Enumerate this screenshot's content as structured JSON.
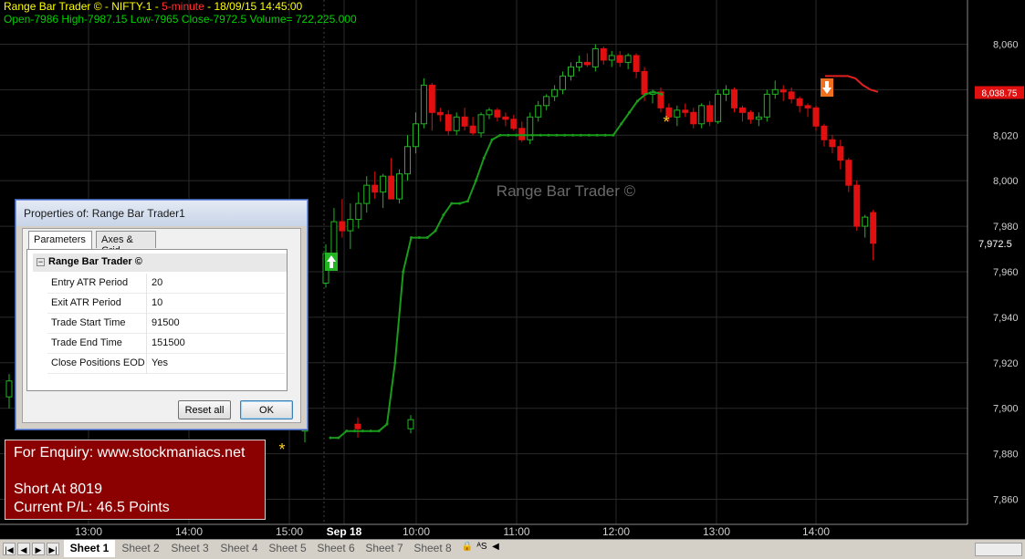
{
  "header": {
    "title_prefix": "Range Bar Trader © - NIFTY-1 - ",
    "interval": "5-minute",
    "title_suffix": " - 18/09/15 14:45:00",
    "ohlc": "Open-7986  High-7987.15  Low-7965  Close-7972.5  Volume= 722,225.000"
  },
  "watermark": "Range Bar Trader ©",
  "dialog": {
    "title": "Properties of: Range Bar Trader1",
    "tabs": [
      "Parameters",
      "Axes & Grid"
    ],
    "group": "Range Bar Trader ©",
    "group_toggle": "−",
    "params": [
      {
        "name": "Entry ATR Period",
        "value": "20"
      },
      {
        "name": "Exit ATR Period",
        "value": "10"
      },
      {
        "name": "Trade Start Time",
        "value": "91500"
      },
      {
        "name": "Trade End Time",
        "value": "151500"
      },
      {
        "name": "Close Positions EOD",
        "value": "Yes"
      }
    ],
    "reset_label": "Reset all",
    "ok_label": "OK"
  },
  "info": {
    "enquiry": "For Enquiry: www.stockmaniacs.net",
    "position": "Short At 8019",
    "pl": "Current P/L: 46.5 Points"
  },
  "sheets": {
    "nav": [
      "|◀",
      "◀",
      "▶",
      "▶|"
    ],
    "tabs": [
      "Sheet 1",
      "Sheet 2",
      "Sheet 3",
      "Sheet 4",
      "Sheet 5",
      "Sheet 6",
      "Sheet 7",
      "Sheet 8"
    ],
    "active": "Sheet 1",
    "extra": [
      "🔒",
      "ᴬS",
      "◀"
    ]
  },
  "colors": {
    "up": "#22b422",
    "down": "#e01010",
    "trail_long": "#1a9a1a",
    "trail_short": "#e02020",
    "grid": "#2a2a2a",
    "axis_text": "#cfcfcf",
    "price_box": "#e01010"
  },
  "chart_data": {
    "type": "candlestick",
    "x_ticks": [
      "13:00",
      "14:00",
      "15:00",
      "Sep 18",
      "10:00",
      "11:00",
      "12:00",
      "13:00",
      "14:00"
    ],
    "y_ticks": [
      "8,060",
      "8,040",
      "8,020",
      "8,000",
      "7,980",
      "7,960",
      "7,940",
      "7,920",
      "7,900",
      "7,880",
      "7,860"
    ],
    "ylim": [
      7855,
      8073
    ],
    "last_price_label": "7,972.5",
    "current_price_box": "8,038.75",
    "grid": true,
    "candles": [
      [
        7905,
        7915,
        7900,
        7912
      ],
      [
        7912,
        7925,
        7908,
        7918
      ],
      [
        7918,
        7920,
        7900,
        7905
      ],
      [
        7890,
        7900,
        7885,
        7893
      ],
      [
        7893,
        7896,
        7887,
        7891
      ],
      [
        7891,
        7897,
        7889,
        7895
      ],
      [
        7955,
        7972,
        7953,
        7968
      ],
      [
        7968,
        7988,
        7964,
        7982
      ],
      [
        7982,
        7992,
        7975,
        7978
      ],
      [
        7978,
        7990,
        7970,
        7983
      ],
      [
        7983,
        7995,
        7979,
        7990
      ],
      [
        7990,
        8002,
        7986,
        7998
      ],
      [
        7998,
        8004,
        7992,
        7995
      ],
      [
        7995,
        8003,
        7988,
        8002
      ],
      [
        8002,
        8010,
        7998,
        7992
      ],
      [
        7992,
        8005,
        7990,
        8003
      ],
      [
        8003,
        8020,
        8000,
        8015
      ],
      [
        8015,
        8030,
        8012,
        8025
      ],
      [
        8025,
        8045,
        8023,
        8042
      ],
      [
        8042,
        8043,
        8022,
        8030
      ],
      [
        8030,
        8032,
        8026,
        8029
      ],
      [
        8029,
        8031,
        8020,
        8022
      ],
      [
        8022,
        8030,
        8020,
        8028
      ],
      [
        8028,
        8032,
        8022,
        8024
      ],
      [
        8024,
        8028,
        8020,
        8021
      ],
      [
        8021,
        8030,
        8019,
        8029
      ],
      [
        8029,
        8032,
        8027,
        8031
      ],
      [
        8031,
        8032,
        8026,
        8028
      ],
      [
        8028,
        8030,
        8024,
        8027
      ],
      [
        8027,
        8029,
        8022,
        8023
      ],
      [
        8023,
        8026,
        8017,
        8018
      ],
      [
        8018,
        8030,
        8016,
        8028
      ],
      [
        8028,
        8035,
        8026,
        8033
      ],
      [
        8033,
        8038,
        8031,
        8037
      ],
      [
        8037,
        8042,
        8035,
        8040
      ],
      [
        8040,
        8048,
        8038,
        8046
      ],
      [
        8046,
        8052,
        8044,
        8050
      ],
      [
        8050,
        8055,
        8048,
        8052
      ],
      [
        8052,
        8056,
        8050,
        8051
      ],
      [
        8050,
        8060,
        8048,
        8058
      ],
      [
        8058,
        8059,
        8051,
        8053
      ],
      [
        8053,
        8057,
        8050,
        8055
      ],
      [
        8055,
        8057,
        8050,
        8052
      ],
      [
        8052,
        8056,
        8049,
        8055
      ],
      [
        8055,
        8056,
        8045,
        8048
      ],
      [
        8048,
        8050,
        8035,
        8038
      ],
      [
        8038,
        8040,
        8034,
        8039
      ],
      [
        8039,
        8041,
        8030,
        8032
      ],
      [
        8032,
        8034,
        8026,
        8028
      ],
      [
        8028,
        8033,
        8024,
        8031
      ],
      [
        8031,
        8034,
        8028,
        8030
      ],
      [
        8030,
        8032,
        8023,
        8025
      ],
      [
        8025,
        8034,
        8023,
        8033
      ],
      [
        8033,
        8035,
        8024,
        8026
      ],
      [
        8026,
        8040,
        8025,
        8038
      ],
      [
        8038,
        8042,
        8035,
        8040
      ],
      [
        8040,
        8041,
        8030,
        8032
      ],
      [
        8032,
        8033,
        8026,
        8030
      ],
      [
        8030,
        8031,
        8025,
        8027
      ],
      [
        8027,
        8030,
        8024,
        8028
      ],
      [
        8028,
        8040,
        8026,
        8038
      ],
      [
        8038,
        8044,
        8036,
        8040
      ],
      [
        8040,
        8042,
        8035,
        8039
      ],
      [
        8039,
        8041,
        8034,
        8036
      ],
      [
        8036,
        8037,
        8030,
        8033
      ],
      [
        8033,
        8034,
        8028,
        8032
      ],
      [
        8032,
        8033,
        8022,
        8024
      ],
      [
        8024,
        8025,
        8015,
        8018
      ],
      [
        8018,
        8020,
        8012,
        8015
      ],
      [
        8015,
        8018,
        8005,
        8009
      ],
      [
        8009,
        8010,
        7995,
        7998
      ],
      [
        7998,
        8000,
        7978,
        7980
      ],
      [
        7980,
        7985,
        7975,
        7984
      ],
      [
        7986,
        7987.15,
        7965,
        7972.5
      ]
    ],
    "trail_long": [
      [
        7887,
        7887,
        7890,
        7890,
        7890,
        7890,
        7890,
        7893,
        7920,
        7960,
        7975,
        7975,
        7975,
        7978,
        7985,
        7990,
        7990,
        7991,
        8000,
        8010,
        8018,
        8020,
        8020,
        8020,
        8020,
        8020,
        8020,
        8020,
        8020,
        8020,
        8020,
        8020,
        8020,
        8020,
        8020,
        8020,
        8025,
        8030,
        8035,
        8038,
        8039,
        8038
      ]
    ],
    "trail_short": [
      8046,
      8046,
      8046,
      8046,
      8045,
      8042,
      8040,
      8039
    ]
  }
}
